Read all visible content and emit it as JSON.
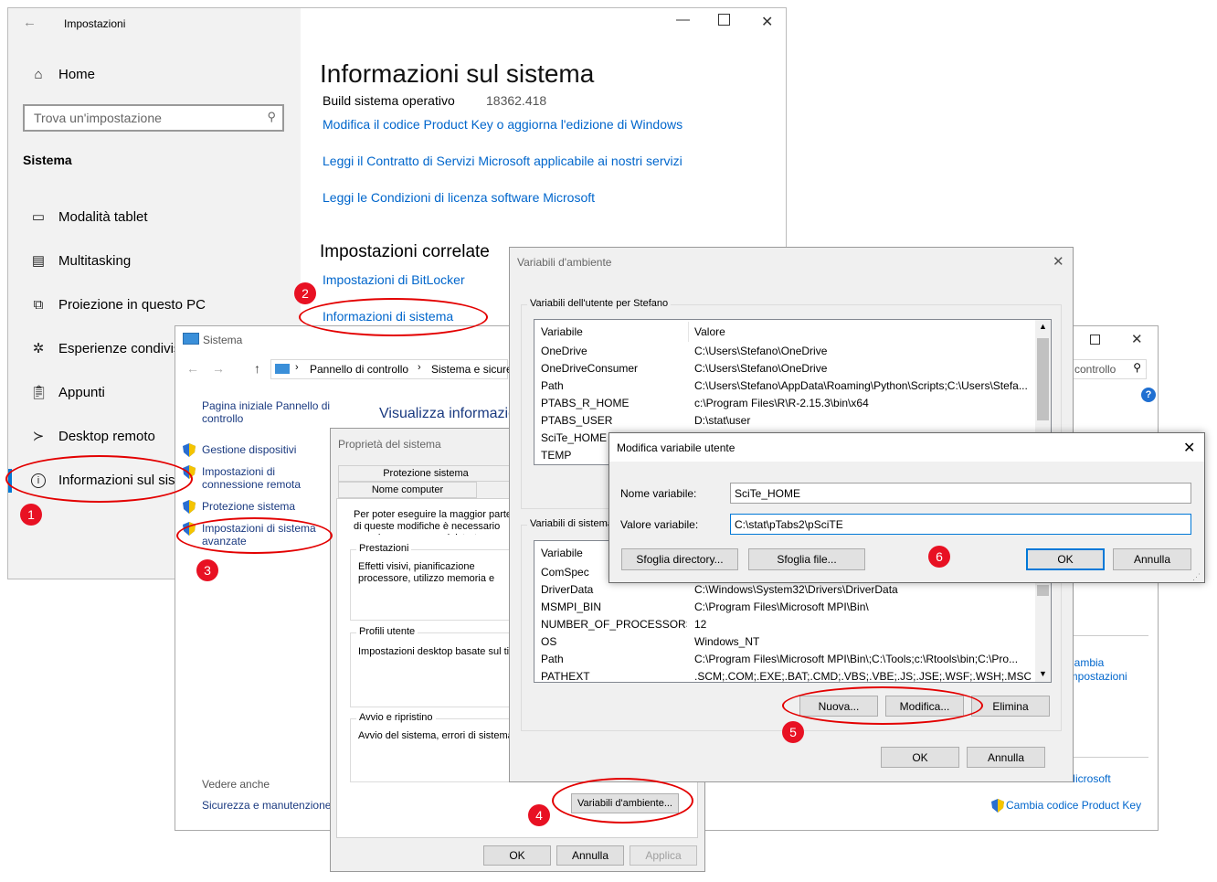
{
  "settings": {
    "title": "Impostazioni",
    "home": "Home",
    "search_placeholder": "Trova un'impostazione",
    "section": "Sistema",
    "nav": [
      {
        "label": "Modalità tablet",
        "icon": "tablet-icon"
      },
      {
        "label": "Multitasking",
        "icon": "multitasking-icon"
      },
      {
        "label": "Proiezione in questo PC",
        "icon": "projection-icon"
      },
      {
        "label": "Esperienze condivise",
        "icon": "shared-experiences-icon"
      },
      {
        "label": "Appunti",
        "icon": "clipboard-icon"
      },
      {
        "label": "Desktop remoto",
        "icon": "remote-desktop-icon"
      },
      {
        "label": "Informazioni sul sistema",
        "icon": "info-icon"
      }
    ],
    "page_title": "Informazioni sul sistema",
    "build_label": "Build sistema operativo",
    "build_value": "18362.418",
    "links": [
      "Modifica il codice Product Key o aggiorna l'edizione di Windows",
      "Leggi il Contratto di Servizi Microsoft applicabile ai nostri servizi",
      "Leggi le Condizioni di licenza software Microsoft"
    ],
    "related_title": "Impostazioni correlate",
    "related_links": [
      "Impostazioni di BitLocker",
      "Informazioni di sistema"
    ]
  },
  "control_panel": {
    "title": "Sistema",
    "breadcrumb": [
      "Pannello di controllo",
      "Sistema e sicurezza"
    ],
    "search_text": "controllo",
    "side_home": "Pagina iniziale Pannello di controllo",
    "side_links": [
      "Gestione dispositivi",
      "Impostazioni di connessione remota",
      "Protezione sistema",
      "Impostazioni di sistema avanzate"
    ],
    "heading": "Visualizza informazioni",
    "see_also": "Vedere anche",
    "see_also_link": "Sicurezza e manutenzione",
    "right_links": [
      "Cambia",
      "impostazioni",
      "Microsoft"
    ],
    "product_key_link": "Cambia codice Product Key"
  },
  "system_properties": {
    "title": "Proprietà del sistema",
    "tabs_row1": [
      "Protezione sistema"
    ],
    "tabs_row2": [
      "Nome computer"
    ],
    "intro": "Per poter eseguire la maggior parte di queste modifiche è necessario accedere come amministratore.",
    "groups": [
      {
        "label": "Prestazioni",
        "text": "Effetti visivi, pianificazione processore, utilizzo memoria e memoria virtuale"
      },
      {
        "label": "Profili utente",
        "text": "Impostazioni desktop basate sul tipo di accesso"
      },
      {
        "label": "Avvio e ripristino",
        "text": "Avvio del sistema, errori di sistema e informazioni di debug"
      }
    ],
    "env_button": "Variabili d'ambiente...",
    "ok": "OK",
    "cancel": "Annulla",
    "apply": "Applica"
  },
  "env_vars": {
    "title": "Variabili d'ambiente",
    "user_group": "Variabili dell'utente per Stefano",
    "sys_group": "Variabili di sistema",
    "col_var": "Variabile",
    "col_val": "Valore",
    "user_rows": [
      {
        "name": "OneDrive",
        "value": "C:\\Users\\Stefano\\OneDrive"
      },
      {
        "name": "OneDriveConsumer",
        "value": "C:\\Users\\Stefano\\OneDrive"
      },
      {
        "name": "Path",
        "value": "C:\\Users\\Stefano\\AppData\\Roaming\\Python\\Scripts;C:\\Users\\Stefa..."
      },
      {
        "name": "PTABS_R_HOME",
        "value": "c:\\Program Files\\R\\R-2.15.3\\bin\\x64"
      },
      {
        "name": "PTABS_USER",
        "value": "D:\\stat\\user"
      },
      {
        "name": "SciTe_HOME",
        "value": ""
      },
      {
        "name": "TEMP",
        "value": ""
      }
    ],
    "sys_rows": [
      {
        "name": "ComSpec",
        "value": ""
      },
      {
        "name": "DriverData",
        "value": "C:\\Windows\\System32\\Drivers\\DriverData"
      },
      {
        "name": "MSMPI_BIN",
        "value": "C:\\Program Files\\Microsoft MPI\\Bin\\"
      },
      {
        "name": "NUMBER_OF_PROCESSORS",
        "value": "12"
      },
      {
        "name": "OS",
        "value": "Windows_NT"
      },
      {
        "name": "Path",
        "value": "C:\\Program Files\\Microsoft MPI\\Bin\\;C:\\Tools;c:\\Rtools\\bin;C:\\Pro..."
      },
      {
        "name": "PATHEXT",
        "value": ".SCM;.COM;.EXE;.BAT;.CMD;.VBS;.VBE;.JS;.JSE;.WSF;.WSH;.MSC;.py;..."
      }
    ],
    "new": "Nuova...",
    "edit": "Modifica...",
    "delete": "Elimina",
    "ok": "OK",
    "cancel": "Annulla"
  },
  "edit_var": {
    "title": "Modifica variabile utente",
    "name_label": "Nome variabile:",
    "name_value": "SciTe_HOME",
    "value_label": "Valore variabile:",
    "value_value": "C:\\stat\\pTabs2\\pSciTE",
    "browse_dir": "Sfoglia directory...",
    "browse_file": "Sfoglia file...",
    "ok": "OK",
    "cancel": "Annulla"
  },
  "badges": [
    "1",
    "2",
    "3",
    "4",
    "5",
    "6"
  ],
  "colors": {
    "annotation": "#e30000",
    "badge": "#e81123",
    "link": "#0066cc",
    "accent": "#0078d7"
  }
}
